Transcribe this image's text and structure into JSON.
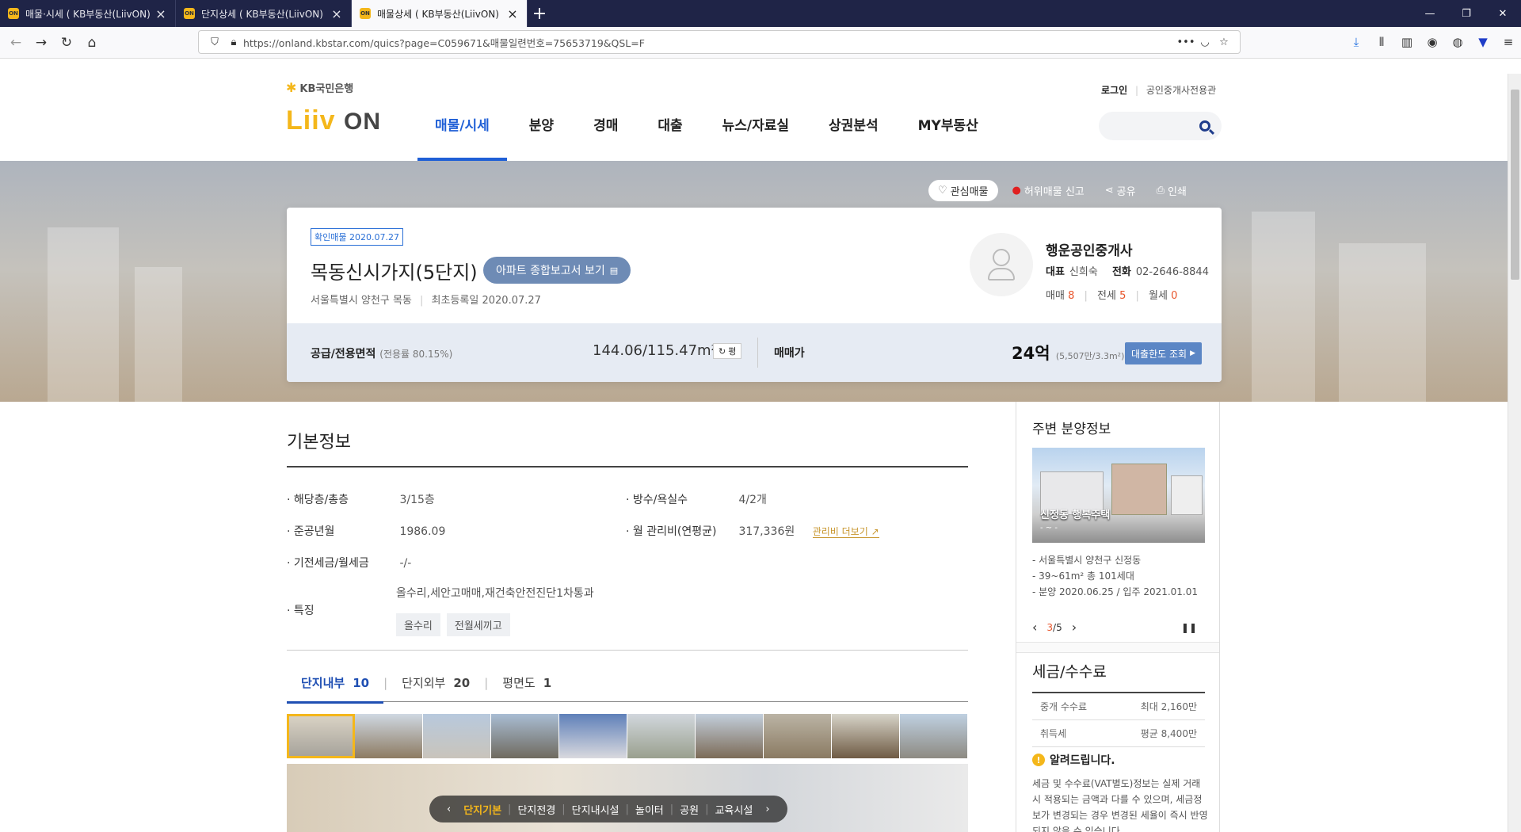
{
  "browser": {
    "tabs": [
      {
        "title": "매물·시세 ( KB부동산(LiivON) |",
        "active": false
      },
      {
        "title": "단지상세 ( KB부동산(LiivON) |",
        "active": false
      },
      {
        "title": "매물상세 ( KB부동산(LiivON) |",
        "active": true
      }
    ],
    "new_tab": "+",
    "url": "https://onland.kbstar.com/quics?page=C059671&매물일련번호=75653719&QSL=F",
    "url_host": "kbstar.com",
    "favicon_text": "ON"
  },
  "header": {
    "kb_brand": "KB국민은행",
    "logo_text": "Liiv",
    "logo_on": "ON",
    "utility": {
      "login": "로그인",
      "agent": "공인중개사전용관"
    },
    "nav": [
      {
        "label": "매물/시세",
        "active": true
      },
      {
        "label": "분양",
        "active": false
      },
      {
        "label": "경매",
        "active": false
      },
      {
        "label": "대출",
        "active": false
      },
      {
        "label": "뉴스/자료실",
        "active": false
      },
      {
        "label": "상권분석",
        "active": false
      },
      {
        "label": "MY부동산",
        "active": false
      }
    ]
  },
  "hero": {
    "favorite": "관심매물",
    "report_fake": "허위매물 신고",
    "share": "공유",
    "print": "인쇄"
  },
  "listing": {
    "verify_badge": "확인매물 2020.07.27",
    "title": "목동신시가지(5단지)",
    "report_button": "아파트 종합보고서 보기",
    "address": "서울특별시 양천구 목동",
    "registered": "최초등록일 2020.07.27",
    "agent": {
      "name": "행운공인중개사",
      "rep_label": "대표",
      "rep_name": "신희숙",
      "phone_label": "전화",
      "phone": "02-2646-8844",
      "sale_label": "매매",
      "sale_count": "8",
      "jeonse_label": "전세",
      "jeonse_count": "5",
      "monthly_label": "월세",
      "monthly_count": "0"
    },
    "area_label": "공급/전용면적",
    "area_ratio": "(전용률 80.15%)",
    "area_value": "144.06/115.47m²",
    "pyeong_button": "평",
    "price_label": "매매가",
    "price": "24억",
    "price_sub": "(5,507만/3.3m²)",
    "loan_button": "대출한도 조회"
  },
  "basic_info": {
    "title": "기본정보",
    "floor_label": "해당층/총층",
    "floor_value": "3/15층",
    "rooms_label": "방수/욕실수",
    "rooms_value": "4/2개",
    "built_label": "준공년월",
    "built_value": "1986.09",
    "mgmt_label": "월 관리비(연평균)",
    "mgmt_value": "317,336원",
    "mgmt_link": "관리비 더보기",
    "deposit_label": "기전세금/월세금",
    "deposit_value": "-/-",
    "feature_label": "특징",
    "feature_text": "올수리,세안고매매,재건축안전진단1차통과",
    "feature_tags": [
      "올수리",
      "전월세끼고"
    ]
  },
  "photo_tabs": [
    {
      "label": "단지내부",
      "count": "10",
      "active": true
    },
    {
      "label": "단지외부",
      "count": "20",
      "active": false
    },
    {
      "label": "평면도",
      "count": "1",
      "active": false
    }
  ],
  "photo_nav": [
    "단지기본",
    "단지전경",
    "단지내시설",
    "놀이터",
    "공원",
    "교육시설"
  ],
  "sidebar": {
    "nearby_title": "주변 분양정보",
    "photo_caption": "신정동 행복주택",
    "photo_sub": "- ~ -",
    "lines": [
      "- 서울특별시 양천구 신정동",
      "- 39~61m² 총 101세대",
      "- 분양 2020.06.25 / 입주 2021.01.01"
    ],
    "pager_current": "3",
    "pager_total": "/5",
    "tax_title": "세금/수수료",
    "tax_rows": [
      {
        "label": "중개 수수료",
        "value": "최대 2,160만"
      },
      {
        "label": "취득세",
        "value": "평균 8,400만"
      }
    ],
    "notice_title": "알려드립니다.",
    "notice_body": "세금 및 수수료(VAT별도)정보는 실제 거래 시 적용되는 금액과 다를 수 있으며, 세금정보가 변경되는 경우 변경된 세율이 즉시 반영되지 않을 수 있습니다."
  }
}
